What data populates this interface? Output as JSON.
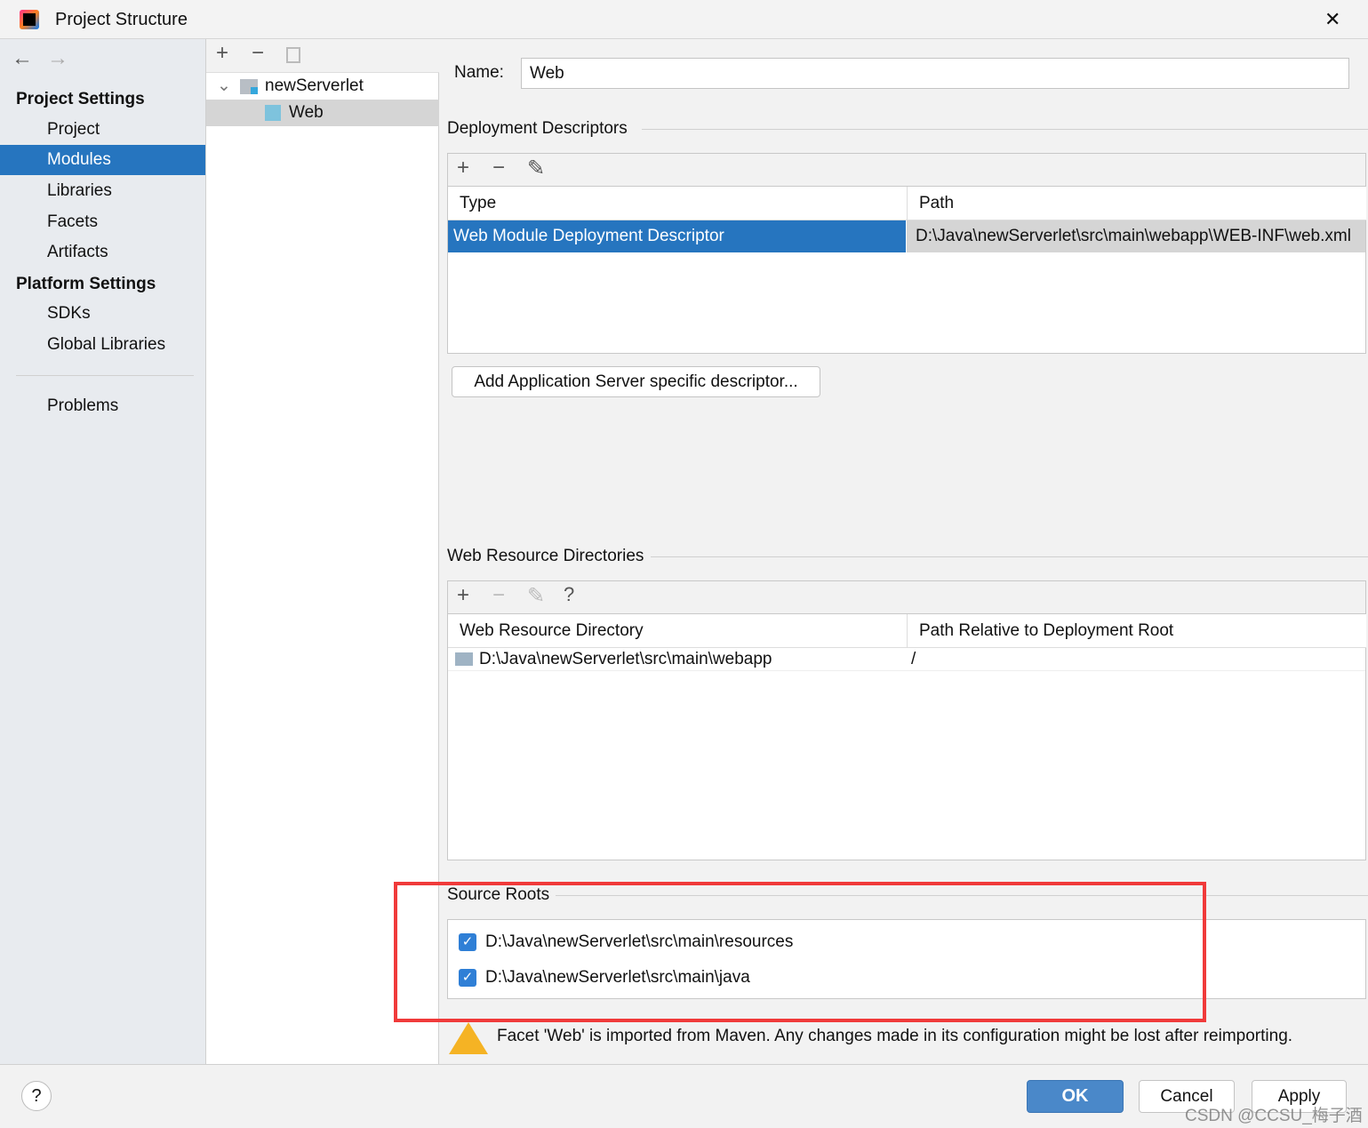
{
  "window": {
    "title": "Project Structure",
    "close": "✕"
  },
  "nav": {
    "back": "←",
    "forward": "→"
  },
  "sidebar": {
    "project_settings": "Project Settings",
    "items1": [
      "Project",
      "Modules",
      "Libraries",
      "Facets",
      "Artifacts"
    ],
    "platform_settings": "Platform Settings",
    "items2": [
      "SDKs",
      "Global Libraries"
    ],
    "problems": "Problems"
  },
  "tree": {
    "root": "newServerlet",
    "child": "Web"
  },
  "name": {
    "label": "Name:",
    "value": "Web"
  },
  "deployment": {
    "title": "Deployment Descriptors",
    "columns": [
      "Type",
      "Path"
    ],
    "rows": [
      [
        "Web Module Deployment Descriptor",
        "D:\\Java\\newServerlet\\src\\main\\webapp\\WEB-INF\\web.xml"
      ]
    ],
    "add_button": "Add Application Server specific descriptor..."
  },
  "webres": {
    "title": "Web Resource Directories",
    "help": "?",
    "columns": [
      "Web Resource Directory",
      "Path Relative to Deployment Root"
    ],
    "rows": [
      [
        "D:\\Java\\newServerlet\\src\\main\\webapp",
        "/"
      ]
    ]
  },
  "source_roots": {
    "title": "Source Roots",
    "items": [
      {
        "path": "D:\\Java\\newServerlet\\src\\main\\resources",
        "checked": true
      },
      {
        "path": "D:\\Java\\newServerlet\\src\\main\\java",
        "checked": true
      }
    ]
  },
  "warning": "Facet 'Web' is imported from Maven. Any changes made in its configuration might be lost after reimporting.",
  "footer": {
    "help": "?",
    "ok": "OK",
    "cancel": "Cancel",
    "apply": "Apply",
    "watermark": "CSDN @CCSU_梅子酒"
  },
  "colors": {
    "selection": "#2675bf",
    "highlight_box": "#f03a3a",
    "ok": "#4a88c9"
  }
}
